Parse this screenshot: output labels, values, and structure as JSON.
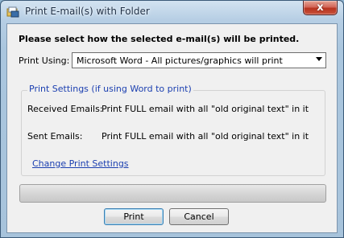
{
  "window": {
    "title": "Print E-mail(s) with Folder",
    "close_glyph": "x",
    "icon": "printer-folder-icon"
  },
  "dialog": {
    "heading": "Please select how the selected e-mail(s) will be printed.",
    "print_using_label": "Print Using:",
    "print_using_value": "Microsoft Word - All pictures/graphics will print"
  },
  "settings": {
    "legend": "Print Settings (if using Word to print)",
    "rows": [
      {
        "label": "Received Emails:",
        "value": "Print FULL email with all \"old original text\" in it"
      },
      {
        "label": "Sent Emails:",
        "value": "Print FULL email with all \"old original text\" in it"
      }
    ],
    "change_link": "Change Print Settings"
  },
  "progress": {
    "value": 0
  },
  "buttons": {
    "print": "Print",
    "cancel": "Cancel"
  },
  "colors": {
    "link": "#1b3fb0",
    "close_red": "#c8523c",
    "title_bar": "#b6cee4"
  }
}
